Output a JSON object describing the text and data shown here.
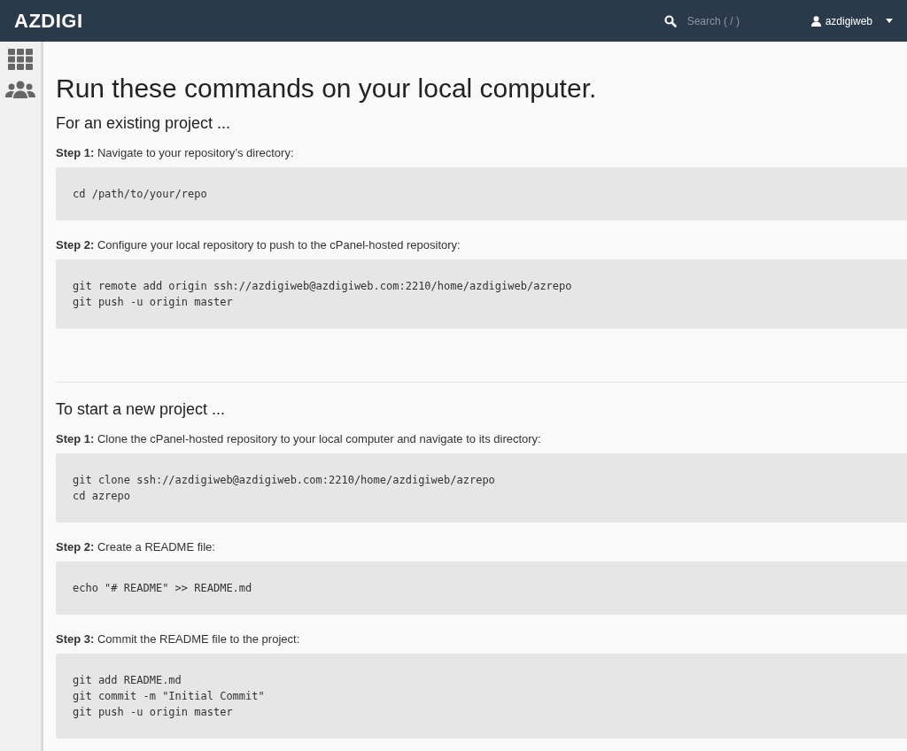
{
  "header": {
    "logo": "AZDIGI",
    "search": {
      "placeholder": "Search ( / )"
    },
    "user": "azdigiweb"
  },
  "page": {
    "title": "Run these commands on your local computer.",
    "sections": [
      {
        "heading": "For an existing project ...",
        "steps": [
          {
            "text": "**Step 1:** Navigate to your repository’s directory:",
            "code": [
              "cd /path/to/your/repo"
            ]
          },
          {
            "text": "**Step 2:** Configure your local repository to push to the cPanel-hosted repository:",
            "code": [
              "git remote add origin ssh://azdigiweb@azdigiweb.com:2210/home/azdigiweb/azrepo",
              "git push -u origin master"
            ]
          }
        ]
      },
      {
        "heading": "To start a new project ...",
        "steps": [
          {
            "text": "**Step 1:** Clone the cPanel-hosted repository to your local computer and navigate to its directory:",
            "code": [
              "git clone ssh://azdigiweb@azdigiweb.com:2210/home/azdigiweb/azrepo",
              "cd azrepo"
            ]
          },
          {
            "text": "**Step 2:** Create a README file:",
            "code": [
              "echo \"# README\" >> README.md"
            ]
          },
          {
            "text": "**Step 3:** Commit the README file to the project:",
            "code": [
              "git add README.md",
              "git commit -m \"Initial Commit\"",
              "git push -u origin master"
            ]
          }
        ]
      }
    ]
  }
}
